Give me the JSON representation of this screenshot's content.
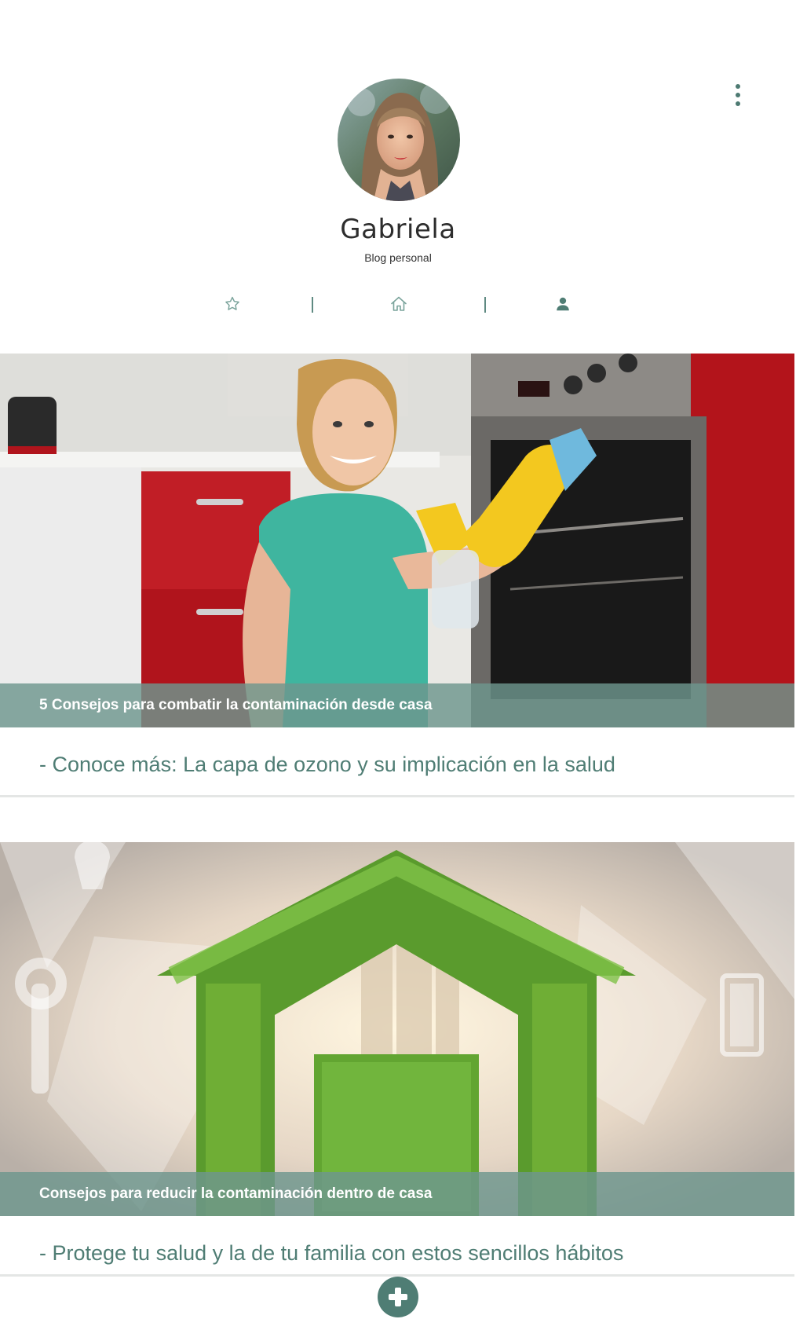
{
  "header": {
    "name": "Gabriela",
    "subtitle": "Blog personal",
    "menu_icon": "more-vertical-icon"
  },
  "tabs": [
    {
      "icon": "star-icon",
      "active": false
    },
    {
      "icon": "home-icon",
      "active": false
    },
    {
      "icon": "user-icon",
      "active": true
    }
  ],
  "posts": [
    {
      "caption": "5 Consejos para combatir la contaminación desde casa",
      "link_text": "- Conoce más: La capa de ozono y su implicación en la salud"
    },
    {
      "caption": "Consejos para reducir la contaminación dentro de casa",
      "link_text": "- Protege tu salud y la de tu familia con estos sencillos hábitos"
    }
  ],
  "fab_icon": "add-icon",
  "colors": {
    "accent": "#4f7d74",
    "caption_bg": "#6e968e",
    "divider": "#e4e6e5"
  }
}
